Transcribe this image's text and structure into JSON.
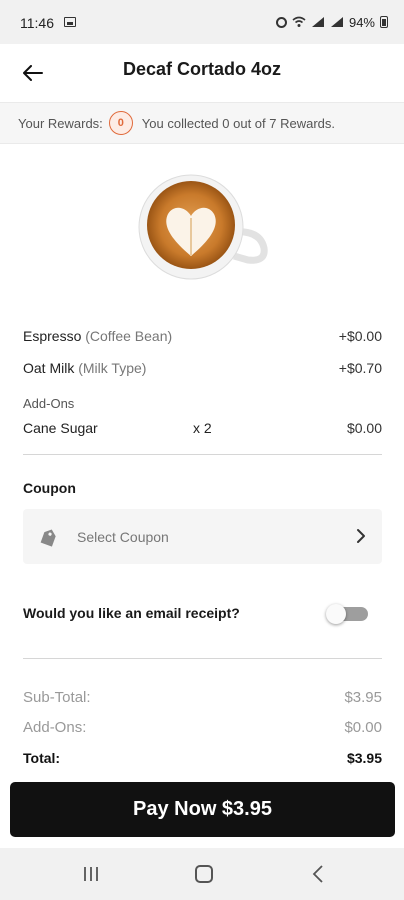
{
  "status_bar": {
    "time": "11:46",
    "battery": "94%"
  },
  "header": {
    "title": "Decaf Cortado 4oz",
    "back_icon": "arrow-left-icon"
  },
  "rewards": {
    "label": "Your Rewards:",
    "count": "0",
    "message": "You collected 0 out of 7 Rewards."
  },
  "product": {
    "image_icon": "latte-art-cup-icon"
  },
  "order": {
    "options": [
      {
        "name": "Espresso",
        "type": "(Coffee Bean)",
        "price": "+$0.00"
      },
      {
        "name": "Oat Milk",
        "type": "(Milk Type)",
        "price": "+$0.70"
      }
    ],
    "addons_label": "Add-Ons",
    "addons": [
      {
        "name": "Cane Sugar",
        "qty": "x 2",
        "price": "$0.00"
      }
    ]
  },
  "coupon": {
    "title": "Coupon",
    "placeholder": "Select Coupon",
    "icon": "tag-icon"
  },
  "receipt": {
    "label": "Would you like an email receipt?",
    "enabled": false
  },
  "totals": {
    "subtotal_label": "Sub-Total:",
    "subtotal": "$3.95",
    "addons_label": "Add-Ons:",
    "addons": "$0.00",
    "total_label": "Total:",
    "total": "$3.95"
  },
  "pay_button": {
    "label": "Pay Now $3.95"
  },
  "colors": {
    "accent": "#e06a3b",
    "button": "#111111"
  }
}
